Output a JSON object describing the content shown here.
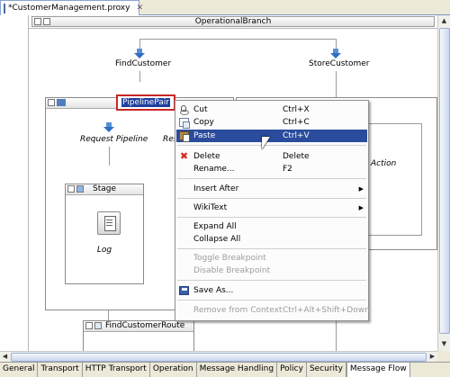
{
  "editor_tab": {
    "title": "*CustomerManagement.proxy",
    "close_glyph": "✕"
  },
  "canvas": {
    "branch_title": "OperationalBranch",
    "find_customer": "FindCustomer",
    "store_customer": "StoreCustomer",
    "pipeline_pair": "PipelinePair",
    "request_pipeline": "Request Pipeline",
    "response_partial": "Res",
    "stage_title": "Stage",
    "log_label": "Log",
    "action_partial": "Action",
    "route_title": "FindCustomerRoute"
  },
  "context_menu": {
    "items": [
      {
        "label": "Cut",
        "shortcut": "Ctrl+X",
        "icon": "cut-icon",
        "state": "normal"
      },
      {
        "label": "Copy",
        "shortcut": "Ctrl+C",
        "icon": "copy-icon",
        "state": "normal"
      },
      {
        "label": "Paste",
        "shortcut": "Ctrl+V",
        "icon": "paste-icon",
        "state": "highlighted"
      },
      {
        "label": "Delete",
        "shortcut": "Delete",
        "icon": "delete-icon",
        "state": "normal"
      },
      {
        "label": "Rename...",
        "shortcut": "F2",
        "icon": "",
        "state": "normal"
      },
      {
        "label": "Insert After",
        "shortcut": "",
        "icon": "",
        "state": "submenu"
      },
      {
        "label": "WikiText",
        "shortcut": "",
        "icon": "",
        "state": "submenu"
      },
      {
        "label": "Expand All",
        "shortcut": "",
        "icon": "",
        "state": "normal"
      },
      {
        "label": "Collapse All",
        "shortcut": "",
        "icon": "",
        "state": "normal"
      },
      {
        "label": "Toggle Breakpoint",
        "shortcut": "",
        "icon": "",
        "state": "disabled"
      },
      {
        "label": "Disable Breakpoint",
        "shortcut": "",
        "icon": "",
        "state": "disabled"
      },
      {
        "label": "Save As...",
        "shortcut": "",
        "icon": "save-icon",
        "state": "normal"
      },
      {
        "label": "Remove from Context",
        "shortcut": "Ctrl+Alt+Shift+Down",
        "icon": "",
        "state": "disabled"
      }
    ]
  },
  "bottom_tabs": [
    {
      "label": "General",
      "active": false
    },
    {
      "label": "Transport",
      "active": false
    },
    {
      "label": "HTTP Transport",
      "active": false
    },
    {
      "label": "Operation",
      "active": false
    },
    {
      "label": "Message Handling",
      "active": false
    },
    {
      "label": "Policy",
      "active": false
    },
    {
      "label": "Security",
      "active": false
    },
    {
      "label": "Message Flow",
      "active": true
    }
  ],
  "colors": {
    "menu_highlight": "#2b4c9c",
    "selection_box": "#c62828",
    "flow_arrow": "#2f6dc4"
  }
}
